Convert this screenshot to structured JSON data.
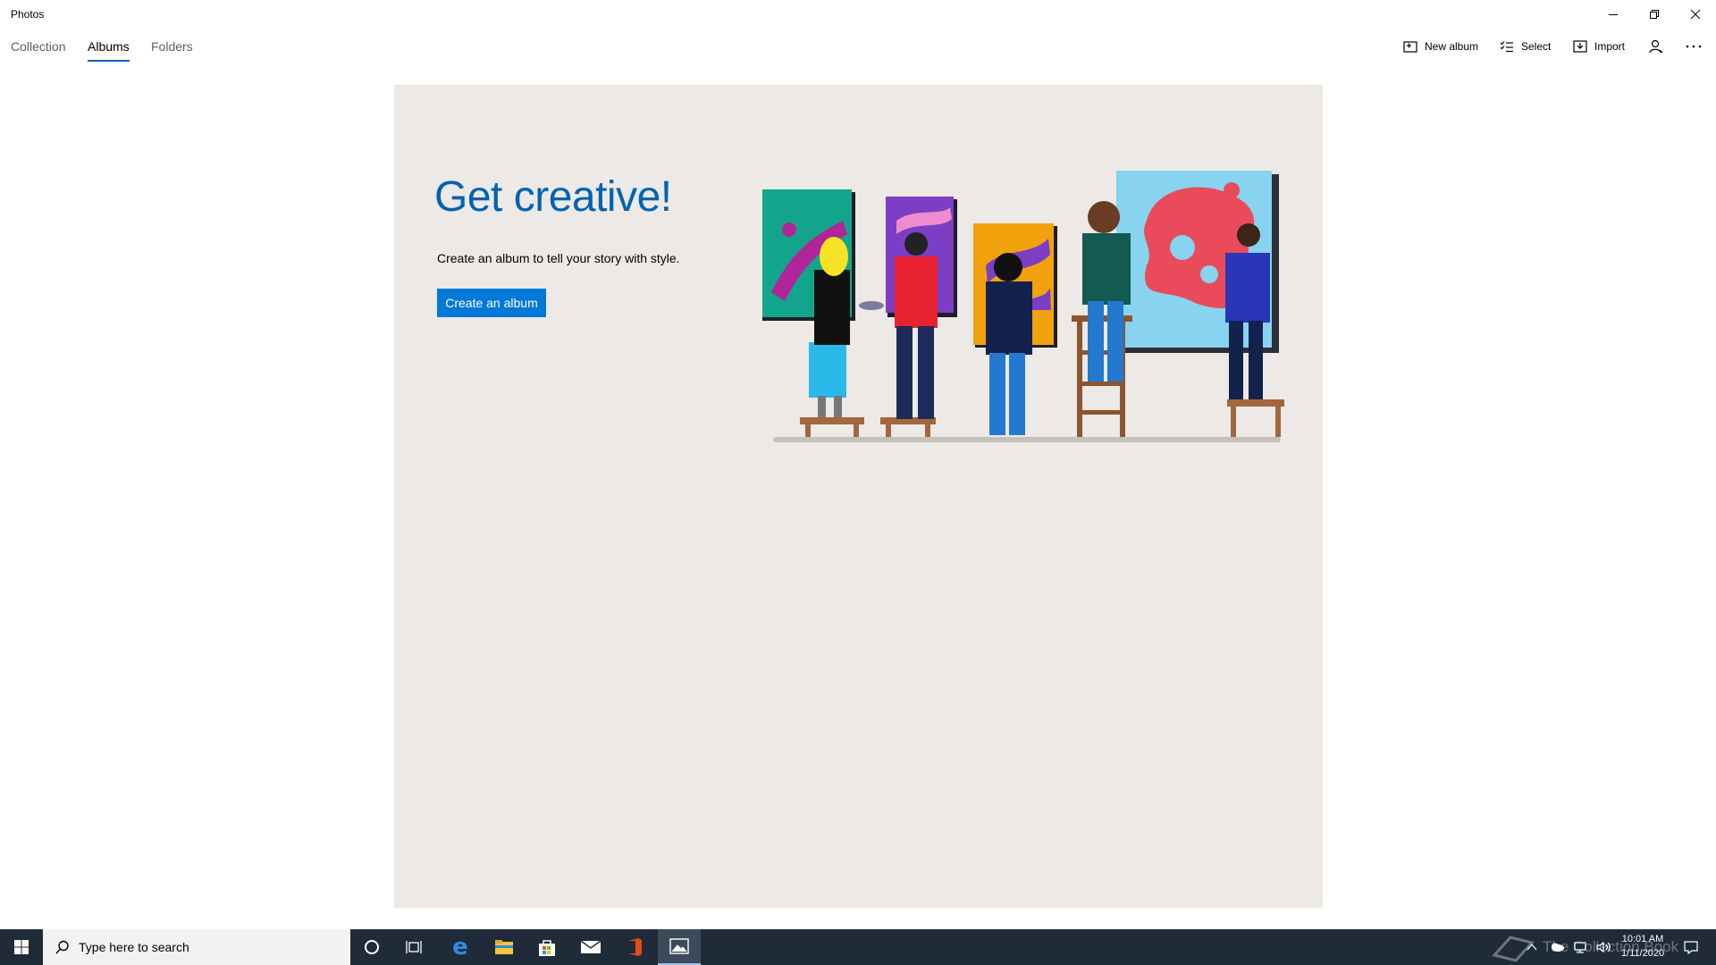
{
  "window": {
    "title": "Photos"
  },
  "tabs": [
    {
      "label": "Collection",
      "active": false
    },
    {
      "label": "Albums",
      "active": true
    },
    {
      "label": "Folders",
      "active": false
    }
  ],
  "toolbar": {
    "new_album": "New album",
    "select": "Select",
    "import": "Import",
    "account_icon": "person-icon",
    "more_icon": "more-dots-icon"
  },
  "main": {
    "headline": "Get creative!",
    "subtext": "Create an album to tell your story with style.",
    "cta_label": "Create an album"
  },
  "taskbar": {
    "search_placeholder": "Type here to search",
    "apps": [
      "cortana-icon",
      "task-view-icon",
      "edge-icon",
      "file-explorer-icon",
      "store-icon",
      "mail-icon",
      "office-icon",
      "photos-icon"
    ],
    "time": "10:01 AM",
    "date": "1/11/2020",
    "watermark": "The Collection Book"
  },
  "colors": {
    "accent": "#0063b1",
    "button": "#0078d7",
    "panel_bg": "#ece9e6",
    "taskbar_bg": "#1f2b38"
  }
}
